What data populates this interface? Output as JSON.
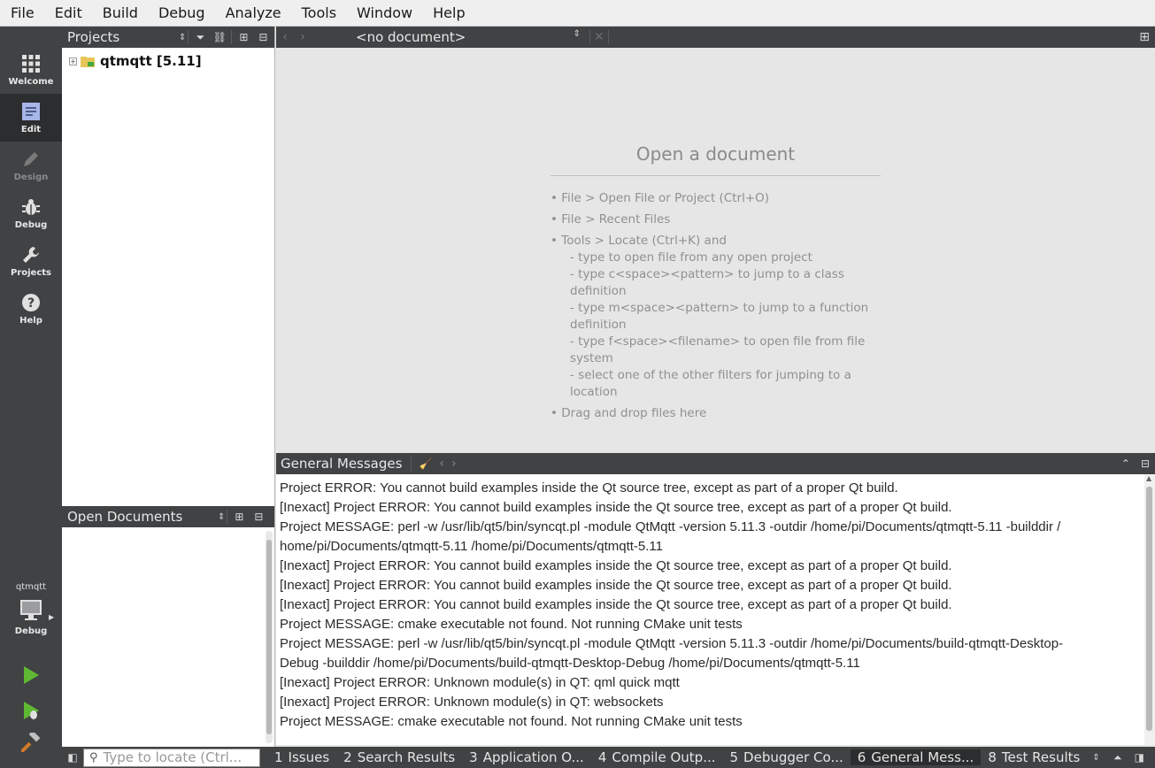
{
  "menubar": {
    "items": [
      {
        "label": "File"
      },
      {
        "label": "Edit"
      },
      {
        "label": "Build"
      },
      {
        "label": "Debug"
      },
      {
        "label": "Analyze"
      },
      {
        "label": "Tools"
      },
      {
        "label": "Window"
      },
      {
        "label": "Help"
      }
    ]
  },
  "modes": [
    {
      "label": "Welcome",
      "icon": "grid-icon"
    },
    {
      "label": "Edit",
      "icon": "document-icon",
      "active": true
    },
    {
      "label": "Design",
      "icon": "pencil-icon",
      "disabled": true
    },
    {
      "label": "Debug",
      "icon": "bug-icon"
    },
    {
      "label": "Projects",
      "icon": "wrench-icon"
    },
    {
      "label": "Help",
      "icon": "question-icon"
    }
  ],
  "kit": {
    "project": "qtmqtt",
    "build_config": "Debug"
  },
  "projects_pane": {
    "title": "Projects",
    "tree": [
      {
        "label": "qtmqtt [5.11]"
      }
    ]
  },
  "open_documents_pane": {
    "title": "Open Documents"
  },
  "editor": {
    "document_combo": "<no document>",
    "open_title": "Open a document",
    "hints": [
      "• File > Open File or Project (Ctrl+O)",
      "• File > Recent Files",
      "• Tools > Locate (Ctrl+K) and"
    ],
    "sub_hints": [
      "- type to open file from any open project",
      "- type c<space><pattern> to jump to a class definition",
      "- type m<space><pattern> to jump to a function definition",
      "- type f<space><filename> to open file from file system",
      "- select one of the other filters for jumping to a location"
    ],
    "final_hint": "• Drag and drop files here"
  },
  "output": {
    "title": "General Messages",
    "lines": [
      "Project ERROR: You cannot build examples inside the Qt source tree, except as part of a proper Qt build.",
      "[Inexact] Project ERROR: You cannot build examples inside the Qt source tree, except as part of a proper Qt build.",
      "Project MESSAGE: perl -w /usr/lib/qt5/bin/syncqt.pl -module QtMqtt -version 5.11.3 -outdir /home/pi/Documents/qtmqtt-5.11 -builddir /",
      "home/pi/Documents/qtmqtt-5.11 /home/pi/Documents/qtmqtt-5.11",
      "[Inexact] Project ERROR: You cannot build examples inside the Qt source tree, except as part of a proper Qt build.",
      "[Inexact] Project ERROR: You cannot build examples inside the Qt source tree, except as part of a proper Qt build.",
      "[Inexact] Project ERROR: You cannot build examples inside the Qt source tree, except as part of a proper Qt build.",
      "Project MESSAGE: cmake executable not found. Not running CMake unit tests",
      "Project MESSAGE: perl -w /usr/lib/qt5/bin/syncqt.pl -module QtMqtt -version 5.11.3 -outdir /home/pi/Documents/build-qtmqtt-Desktop-",
      "Debug -builddir /home/pi/Documents/build-qtmqtt-Desktop-Debug /home/pi/Documents/qtmqtt-5.11",
      "[Inexact] Project ERROR: Unknown module(s) in QT: qml quick mqtt",
      "[Inexact] Project ERROR: Unknown module(s) in QT: websockets",
      "Project MESSAGE: cmake executable not found. Not running CMake unit tests"
    ]
  },
  "statusbar": {
    "locator_placeholder": "Type to locate (Ctrl...",
    "tabs": [
      {
        "num": "1",
        "label": "Issues"
      },
      {
        "num": "2",
        "label": "Search Results"
      },
      {
        "num": "3",
        "label": "Application O..."
      },
      {
        "num": "4",
        "label": "Compile Outp..."
      },
      {
        "num": "5",
        "label": "Debugger Co..."
      },
      {
        "num": "6",
        "label": "General Mess...",
        "active": true
      },
      {
        "num": "8",
        "label": "Test Results"
      }
    ]
  },
  "colors": {
    "sidebar": "#404244",
    "active": "#2c2d2e",
    "run_green": "#5fb832"
  }
}
